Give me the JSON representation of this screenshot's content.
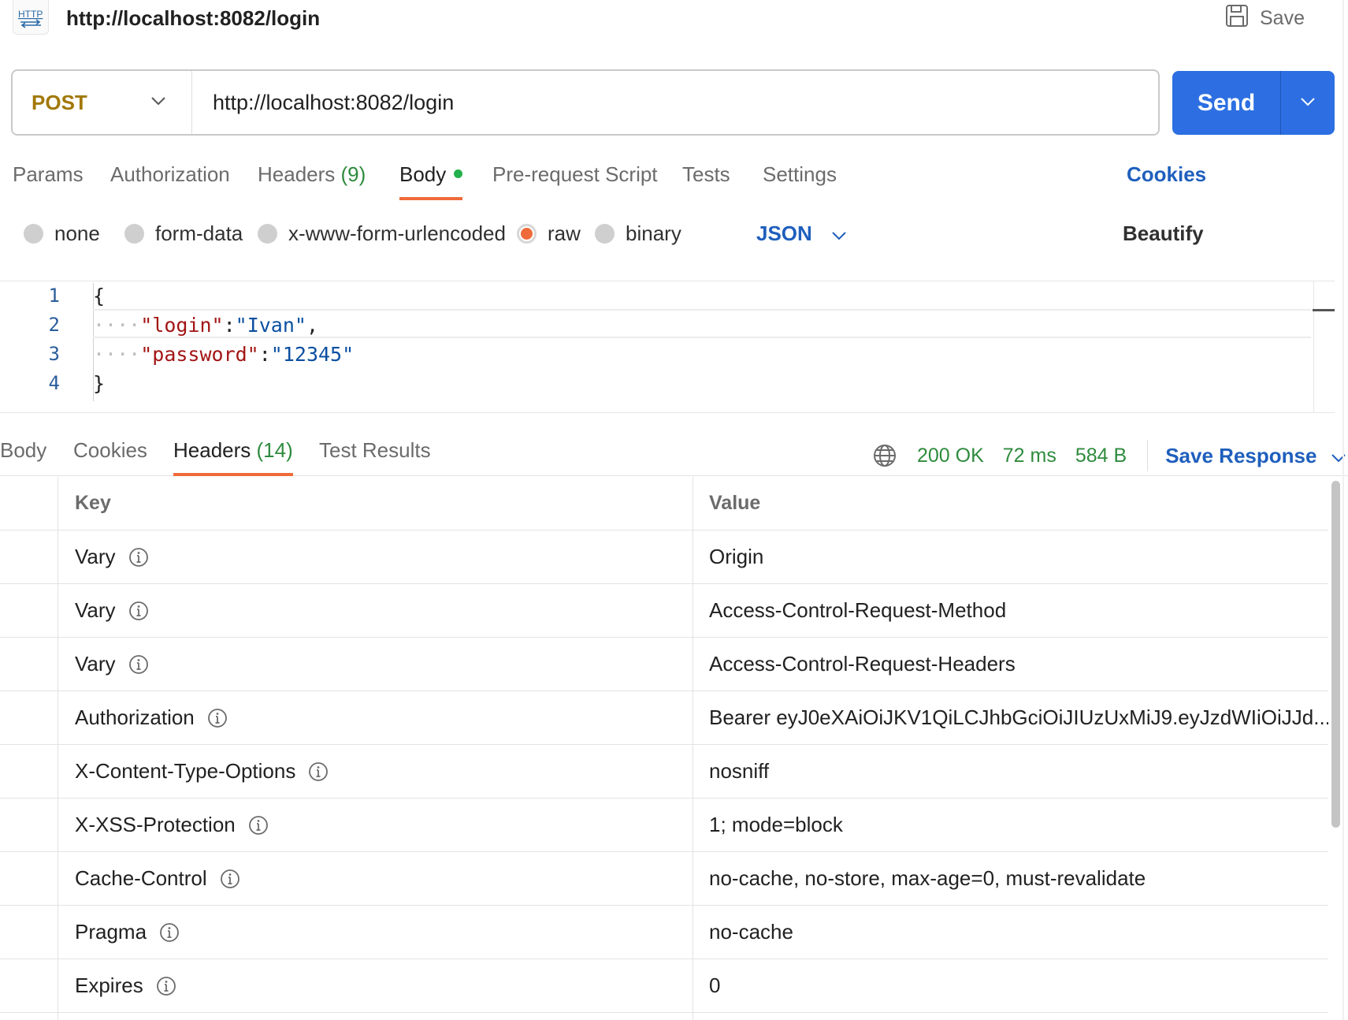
{
  "header": {
    "icon": "http-icon",
    "icon_text": "HTTP",
    "title": "http://localhost:8082/login",
    "save_label": "Save"
  },
  "request": {
    "method": "POST",
    "url": "http://localhost:8082/login",
    "send_label": "Send"
  },
  "request_tabs": {
    "params": "Params",
    "authorization": "Authorization",
    "headers": "Headers",
    "headers_count": "(9)",
    "body": "Body",
    "pre_request": "Pre-request Script",
    "tests": "Tests",
    "settings": "Settings",
    "cookies": "Cookies"
  },
  "body_types": {
    "none": "none",
    "form_data": "form-data",
    "urlencoded": "x-www-form-urlencoded",
    "raw": "raw",
    "binary": "binary",
    "format": "JSON",
    "beautify": "Beautify",
    "selected": "raw"
  },
  "editor": {
    "line_numbers": [
      "1",
      "2",
      "3",
      "4"
    ],
    "open_brace": "{",
    "close_brace": "}",
    "indent": "····",
    "login_key": "\"login\"",
    "login_value": "\"Ivan\"",
    "password_key": "\"password\"",
    "password_value": "\"12345\"",
    "colon": ":",
    "comma": ","
  },
  "response_tabs": {
    "body": "Body",
    "cookies": "Cookies",
    "headers": "Headers",
    "headers_count": "(14)",
    "test_results": "Test Results"
  },
  "response_meta": {
    "status": "200 OK",
    "time": "72 ms",
    "size": "584 B",
    "save_response": "Save Response"
  },
  "headers_table": {
    "key_header": "Key",
    "value_header": "Value",
    "rows": [
      {
        "key": "Vary",
        "value": "Origin"
      },
      {
        "key": "Vary",
        "value": "Access-Control-Request-Method"
      },
      {
        "key": "Vary",
        "value": "Access-Control-Request-Headers"
      },
      {
        "key": "Authorization",
        "value": "Bearer eyJ0eXAiOiJKV1QiLCJhbGciOiJIUzUxMiJ9.eyJzdWIiOiJJd..."
      },
      {
        "key": "X-Content-Type-Options",
        "value": "nosniff"
      },
      {
        "key": "X-XSS-Protection",
        "value": "1; mode=block"
      },
      {
        "key": "Cache-Control",
        "value": "no-cache, no-store, max-age=0, must-revalidate"
      },
      {
        "key": "Pragma",
        "value": "no-cache"
      },
      {
        "key": "Expires",
        "value": "0"
      }
    ]
  },
  "colors": {
    "accent_blue": "#2d6fe2",
    "link_blue": "#1f5fbd",
    "method_post": "#a27804",
    "active_tab_underline": "#ef6b3a",
    "status_green": "#2e8b3d",
    "json_key": "#a31515",
    "json_string": "#0b4fa0"
  }
}
